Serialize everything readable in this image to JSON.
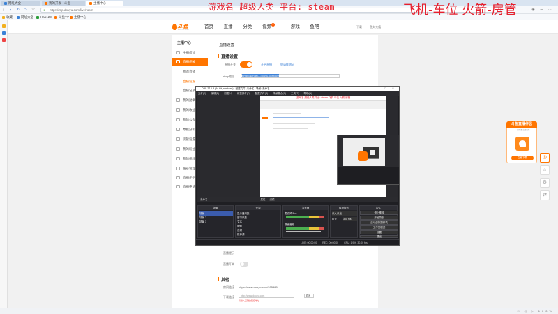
{
  "browser": {
    "tabs": [
      {
        "label": "网址大全",
        "active": false
      },
      {
        "label": "我的开发 - 斗鱼",
        "active": false
      },
      {
        "label": "主播中心",
        "active": true
      }
    ],
    "address": "https://mp.douyu.com/live/room",
    "bookmarks": [
      "收藏",
      "网址大全",
      "Hao123",
      "斗鱼TV",
      "主播中心",
      "我的开发"
    ]
  },
  "overlay": {
    "game_text": "游戏名 超级人类  平台: steam",
    "right_text": "飞机-车位  火箭-房管"
  },
  "site": {
    "logo_text": "斗鱼",
    "logo_sub": "DOUYU.COM",
    "nav": [
      "首页",
      "直播",
      "分类",
      "视频",
      "游戏",
      "鱼吧"
    ],
    "nav_badge": "6",
    "header_right": [
      "下载",
      "鱼丸充值"
    ]
  },
  "side_menu": {
    "heading": "主播中心",
    "items": [
      {
        "label": "主播权益",
        "type": "top"
      },
      {
        "label": "直播相关",
        "type": "active"
      },
      {
        "label": "我的直播",
        "type": "sub"
      },
      {
        "label": "直播设置",
        "type": "active-sub"
      },
      {
        "label": "直播记录",
        "type": "sub"
      },
      {
        "label": "我的勋章",
        "type": "top"
      },
      {
        "label": "我的收益",
        "type": "top"
      },
      {
        "label": "我的公会",
        "type": "top"
      },
      {
        "label": "数据分析",
        "type": "top"
      },
      {
        "label": "房管设置",
        "type": "top"
      },
      {
        "label": "我的粉丝",
        "type": "top"
      },
      {
        "label": "我的视频",
        "type": "top"
      },
      {
        "label": "帐号管理",
        "type": "top"
      },
      {
        "label": "直播伴侣",
        "type": "top"
      },
      {
        "label": "直播申请",
        "type": "top"
      }
    ]
  },
  "main": {
    "section_live": "直播设置",
    "live_switch_label": "直播开关",
    "link_open": "开启直播",
    "link_apply": "申请推流码",
    "rtmp_label": "rtmp地址",
    "rtmp_value": "rtmp://sendfc3.douyu.com/live",
    "section_other": "其他",
    "room_link_label": "房间链接",
    "room_link_value": "https://www.douyu.com/905468",
    "third_switch_label": "直播提示",
    "last_switch_label": "直播开关",
    "download_label": "下载链接",
    "download_placeholder": "http://www.douyu.com",
    "select_value": "关闭",
    "error_text": "请输入正确的链接地址"
  },
  "obs": {
    "title": "OBS 27.1.3 (64-bit, windows) - 配置文件: 未命名 - 场景: 未命名",
    "menu": [
      "文件(F)",
      "编辑(E)",
      "视图(V)",
      "停靠部件(D)",
      "配置文件(P)",
      "场景集合(S)",
      "工具(T)",
      "帮助(H)"
    ],
    "nested_title": "游戏名 超级人类  平台: steam    飞机-车位  火箭-房管",
    "tabs": [
      "未命名",
      "属性",
      "滤镜"
    ],
    "docks": {
      "scenes": {
        "title": "场景",
        "items": [
          "场景",
          "场景 2",
          "场景 3"
        ]
      },
      "sources": {
        "title": "来源",
        "items": [
          "显示器采集",
          "窗口采集",
          "文本",
          "图像",
          "音频",
          "媒体源"
        ]
      },
      "mixer": {
        "title": "混音器",
        "items": [
          "麦克风/Aux",
          "桌面音频"
        ]
      },
      "transitions": {
        "title": "转场特效",
        "items": [
          "淡入淡出",
          "时长",
          "300 ms"
        ]
      },
      "controls": {
        "title": "控件",
        "items": [
          "停止推流",
          "开始录制",
          "启动虚拟摄像机",
          "工作室模式",
          "设置",
          "退出"
        ]
      }
    },
    "status": [
      "LIVE: 00:00:00",
      "REC: 00:00:00",
      "CPU: 1.9%, 30.00 fps"
    ]
  },
  "promo": {
    "title": "斗鱼直播伴侣",
    "sub": "一键开播 高清流畅",
    "button": "立即下载"
  },
  "floating_buttons": [
    "◎",
    "⌂",
    "⚙",
    "⇄"
  ],
  "statusbar": {
    "left": "",
    "right": "□ ◁ ▷ 100%"
  },
  "colors": {
    "accent": "#ff7500",
    "overlay": "#e6202e",
    "link": "#3a7fd5"
  }
}
